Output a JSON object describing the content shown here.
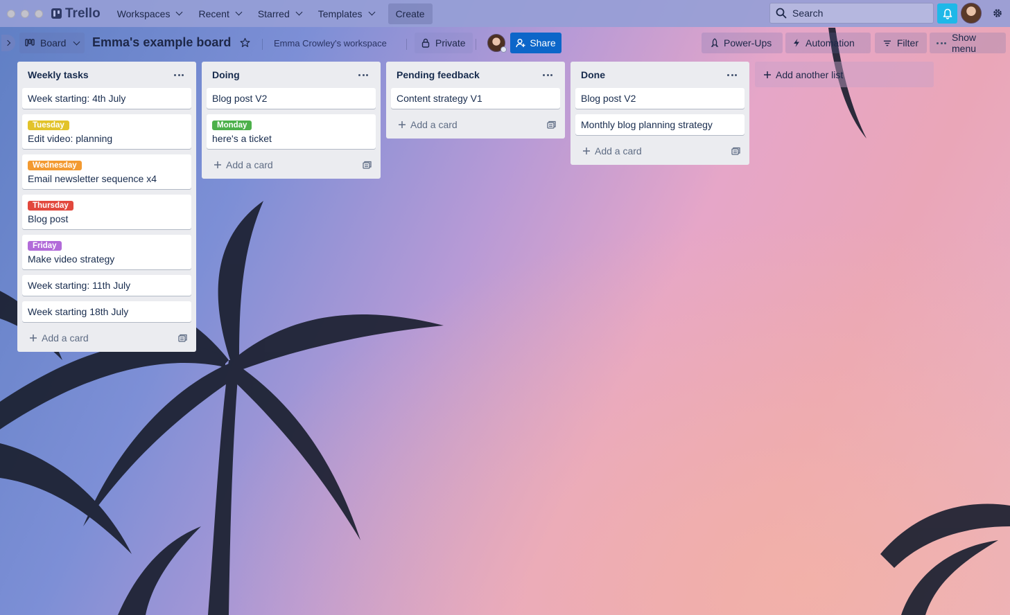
{
  "topbar": {
    "brand": "Trello",
    "nav": [
      {
        "label": "Workspaces"
      },
      {
        "label": "Recent"
      },
      {
        "label": "Starred"
      },
      {
        "label": "Templates"
      }
    ],
    "create_label": "Create",
    "search_placeholder": "Search"
  },
  "board": {
    "view_label": "Board",
    "title": "Emma's example board",
    "workspace": "Emma Crowley's workspace",
    "visibility": "Private",
    "share_label": "Share",
    "powerups_label": "Power-Ups",
    "automation_label": "Automation",
    "filter_label": "Filter",
    "menu_label": "Show menu"
  },
  "lists": [
    {
      "title": "Weekly tasks",
      "cards": [
        {
          "text": "Week starting: 4th July"
        },
        {
          "label": "Tuesday",
          "label_color": "#e2c32a",
          "text": "Edit video: planning"
        },
        {
          "label": "Wednesday",
          "label_color": "#f39a31",
          "text": "Email newsletter sequence x4"
        },
        {
          "label": "Thursday",
          "label_color": "#e2483d",
          "text": "Blog post"
        },
        {
          "label": "Friday",
          "label_color": "#b26bd9",
          "text": "Make video strategy"
        },
        {
          "text": "Week starting: 11th July"
        },
        {
          "text": "Week starting 18th July"
        }
      ],
      "add_label": "Add a card"
    },
    {
      "title": "Doing",
      "cards": [
        {
          "text": "Blog post V2"
        },
        {
          "label": "Monday",
          "label_color": "#4cb04a",
          "text": "here's a ticket"
        }
      ],
      "add_label": "Add a card"
    },
    {
      "title": "Pending feedback",
      "cards": [
        {
          "text": "Content strategy V1"
        }
      ],
      "add_label": "Add a card"
    },
    {
      "title": "Done",
      "cards": [
        {
          "text": "Blog post V2"
        },
        {
          "text": "Monthly blog planning strategy"
        }
      ],
      "add_label": "Add a card"
    }
  ],
  "add_list_label": "Add another list",
  "colors": {
    "share_button": "#0c66c9",
    "notification_button": "#1fb8e8",
    "list_background": "#ebecf0"
  }
}
